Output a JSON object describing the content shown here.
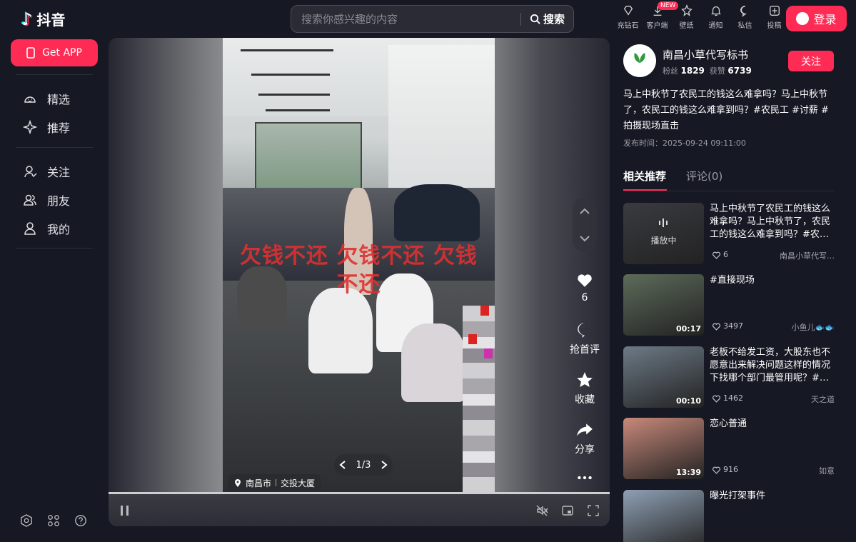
{
  "app": {
    "logo_glyph": "♪",
    "name": "抖音"
  },
  "search": {
    "placeholder": "搜索你感兴趣的内容",
    "button_label": "搜索"
  },
  "top_icons": [
    {
      "icon": "diamond-icon",
      "label": "充钻石"
    },
    {
      "icon": "download-icon",
      "label": "客户端",
      "badge": "NEW"
    },
    {
      "icon": "wallpaper-icon",
      "label": "壁纸"
    },
    {
      "icon": "bell-icon",
      "label": "通知"
    },
    {
      "icon": "message-icon",
      "label": "私信"
    },
    {
      "icon": "upload-icon",
      "label": "投稿"
    }
  ],
  "login_label": "登录",
  "sidebar": {
    "get_app": "Get APP",
    "items": [
      {
        "icon": "featured-icon",
        "label": "精选"
      },
      {
        "icon": "recommend-icon",
        "label": "推荐"
      },
      {
        "icon": "follow-icon",
        "label": "关注"
      },
      {
        "icon": "friends-icon",
        "label": "朋友"
      },
      {
        "icon": "profile-icon",
        "label": "我的"
      }
    ]
  },
  "video": {
    "overlay_text": "欠钱不还 欠钱不还 欠钱不还",
    "pager": "1/3",
    "location": {
      "city": "南昌市",
      "place": "交投大厦"
    },
    "actions": {
      "likes": "6",
      "comment": "抢首评",
      "favorite": "收藏",
      "share": "分享"
    }
  },
  "author": {
    "avatar_text": "小草",
    "name": "南昌小草代写标书",
    "fans_label": "粉丝",
    "fans": "1829",
    "likes_label": "获赞",
    "likes": "6739",
    "follow_label": "关注"
  },
  "post": {
    "description": "马上中秋节了农民工的钱这么难拿吗？马上中秋节了，农民工的钱这么难拿到吗？#农民工 #讨薪 #拍摄现场直击",
    "published_label": "发布时间：",
    "published": "2025-09-24 09:11:00"
  },
  "tabs": {
    "related": "相关推荐",
    "comments": "评论(0)"
  },
  "recommendations": [
    {
      "title": "马上中秋节了农民工的钱这么难拿吗？马上中秋节了，农民工的钱这么难拿到吗？#农…",
      "status": "播放中",
      "duration": "",
      "likes": "6",
      "author": "南昌小草代写…",
      "color": "#3a3b40"
    },
    {
      "title": "#直接现场",
      "status": "",
      "duration": "00:17",
      "likes": "3497",
      "author": "小鱼儿🐟🐟",
      "color": "#5d6b5a"
    },
    {
      "title": "老板不给发工资，大股东也不愿意出来解决问题这样的情况下找哪个部门最管用呢？#…",
      "status": "",
      "duration": "00:10",
      "likes": "1462",
      "author": "天之道",
      "color": "#6d7a86"
    },
    {
      "title": "恋心普通",
      "status": "",
      "duration": "13:39",
      "likes": "916",
      "author": "如意",
      "color": "#c8897a"
    },
    {
      "title": "曝光打架事件",
      "status": "",
      "duration": "",
      "likes": "",
      "author": "",
      "color": "#8fa0b4"
    }
  ]
}
